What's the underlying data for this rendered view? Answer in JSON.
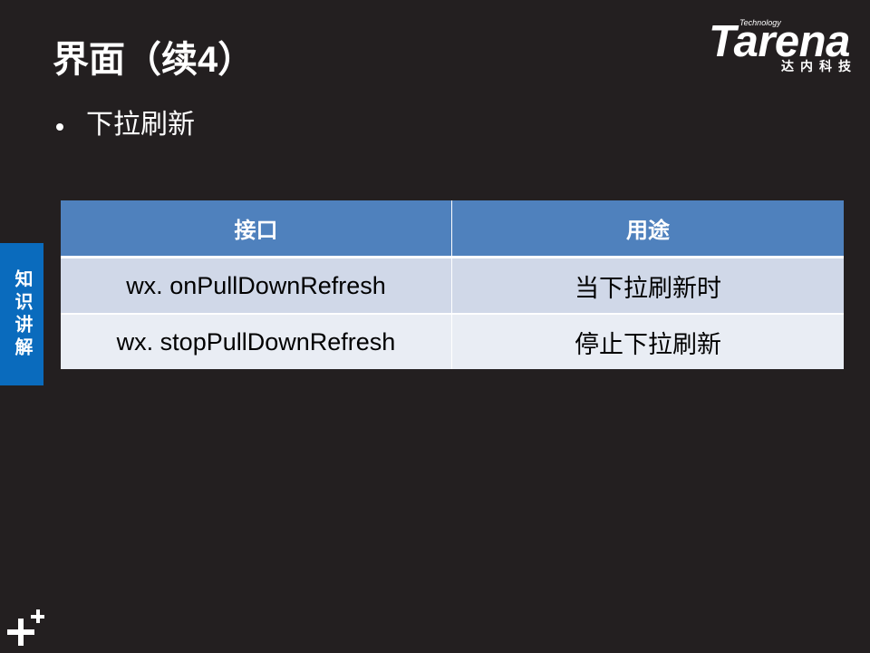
{
  "slide": {
    "title": "界面（续4）",
    "bullets": [
      "下拉刷新"
    ],
    "side_tab": "知识讲解"
  },
  "logo": {
    "brand": "Tarena",
    "tagline_top": "Technology",
    "tagline_cn": "达内科技"
  },
  "table": {
    "headers": [
      "接口",
      "用途"
    ],
    "rows": [
      [
        "wx. onPullDownRefresh",
        "当下拉刷新时"
      ],
      [
        "wx. stopPullDownRefresh",
        "停止下拉刷新"
      ]
    ]
  },
  "icons": {
    "corner_logo": "plus-plus-logo-icon"
  },
  "colors": {
    "background": "#231f20",
    "table_header": "#4f81bd",
    "row_odd": "#d0d8e8",
    "row_even": "#e9edf4",
    "side_tab": "#0a6bbd",
    "text_light": "#ffffff",
    "text_dark": "#000000"
  }
}
